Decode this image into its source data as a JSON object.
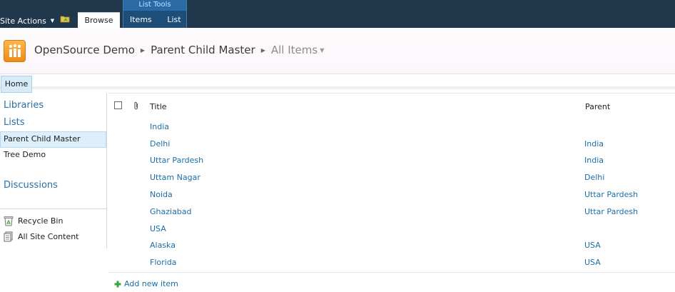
{
  "ribbon": {
    "site_actions_label": "Site Actions",
    "browse_tab": "Browse",
    "list_tools_label": "List Tools",
    "items_tab": "Items",
    "list_tab": "List"
  },
  "breadcrumb": {
    "site": "OpenSource Demo",
    "list": "Parent Child Master",
    "view": "All Items"
  },
  "topnav": {
    "home_label": "Home"
  },
  "quicklaunch": {
    "libraries": "Libraries",
    "lists": "Lists",
    "items": [
      "Parent Child Master",
      "Tree Demo"
    ],
    "discussions": "Discussions",
    "recycle_bin": "Recycle Bin",
    "all_site_content": "All Site Content"
  },
  "listview": {
    "columns": {
      "title": "Title",
      "parent": "Parent"
    },
    "rows": [
      {
        "title": "India",
        "parent": ""
      },
      {
        "title": "Delhi",
        "parent": "India"
      },
      {
        "title": "Uttar Pardesh",
        "parent": "India"
      },
      {
        "title": "Uttam Nagar",
        "parent": "Delhi"
      },
      {
        "title": "Noida",
        "parent": "Uttar Pardesh"
      },
      {
        "title": "Ghaziabad",
        "parent": "Uttar Pardesh"
      },
      {
        "title": "USA",
        "parent": ""
      },
      {
        "title": "Alaska",
        "parent": "USA"
      },
      {
        "title": "Florida",
        "parent": "USA"
      }
    ],
    "add_new_item": "Add new item"
  },
  "colors": {
    "ribbon_bg": "#21374c",
    "link": "#1a6ea8",
    "selected_bg": "#dceffb"
  }
}
